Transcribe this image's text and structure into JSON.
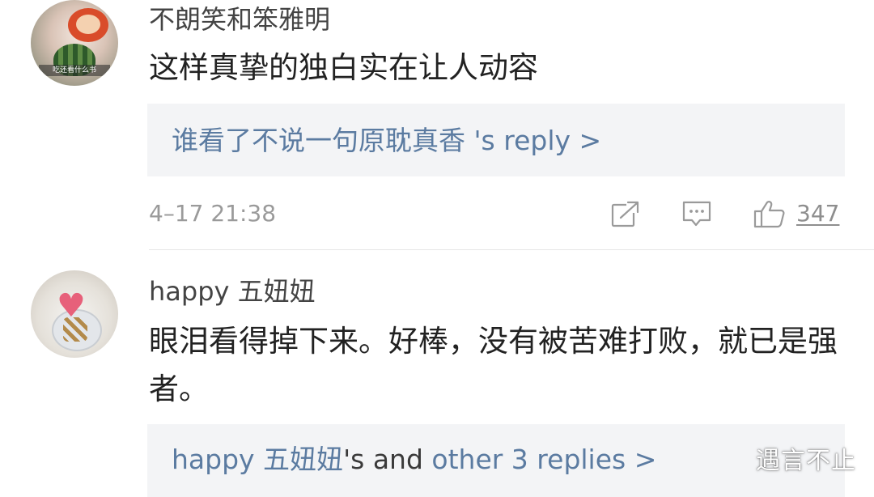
{
  "comments": [
    {
      "username": "不朗笑和笨雅明",
      "avatar_caption": "吃还看什么书",
      "text": "这样真挚的独白实在让人动容",
      "reply_link": {
        "user": "谁看了不说一句原耽真香",
        "rest": " 's reply >"
      },
      "timestamp": "4–17 21:38",
      "like_count": "347",
      "icons": [
        "share-icon",
        "comment-icon",
        "like-icon"
      ]
    },
    {
      "username": "happy 五妞妞",
      "text": "眼泪看得掉下来。好棒，没有被苦难打败，就已是强者。",
      "reply_link": {
        "user": "happy 五妞妞",
        "middle": "'s and ",
        "rest": "other 3 replies >"
      }
    }
  ],
  "watermark": "遇言不止",
  "colors": {
    "link": "#5b7ba1",
    "reply_bg": "#f3f4f6",
    "text": "#222222",
    "meta": "#9a9a9a"
  }
}
